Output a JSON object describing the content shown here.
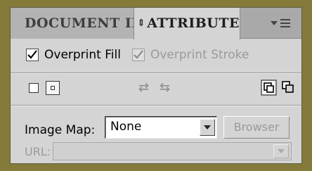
{
  "tabs": [
    {
      "label": "DOCUMENT INFO"
    },
    {
      "label": "ATTRIBUTES",
      "icon": "reorder-arrows-icon"
    }
  ],
  "panel_menu": {
    "icon": "panel-menu-icon"
  },
  "overprint": {
    "fill": {
      "label": "Overprint Fill",
      "checked": true
    },
    "stroke": {
      "label": "Overprint Stroke",
      "checked": true,
      "disabled": true
    }
  },
  "icon_row": {
    "left_icons": [
      "hide-center-icon",
      "show-center-icon"
    ],
    "middle_icons": [
      "reverse-path-direction-off-icon",
      "reverse-path-direction-on-icon"
    ],
    "right_icons": [
      "use-non-zero-winding-fill-rule-icon",
      "use-even-odd-fill-rule-icon"
    ]
  },
  "image_map": {
    "label": "Image Map:",
    "selected": "None",
    "browser_label": "Browser"
  },
  "url": {
    "label": "URL:",
    "value": ""
  },
  "colors": {
    "frame": "#847a3a",
    "panel": "#d4d4d4",
    "tabbar": "#a9a9a9"
  }
}
